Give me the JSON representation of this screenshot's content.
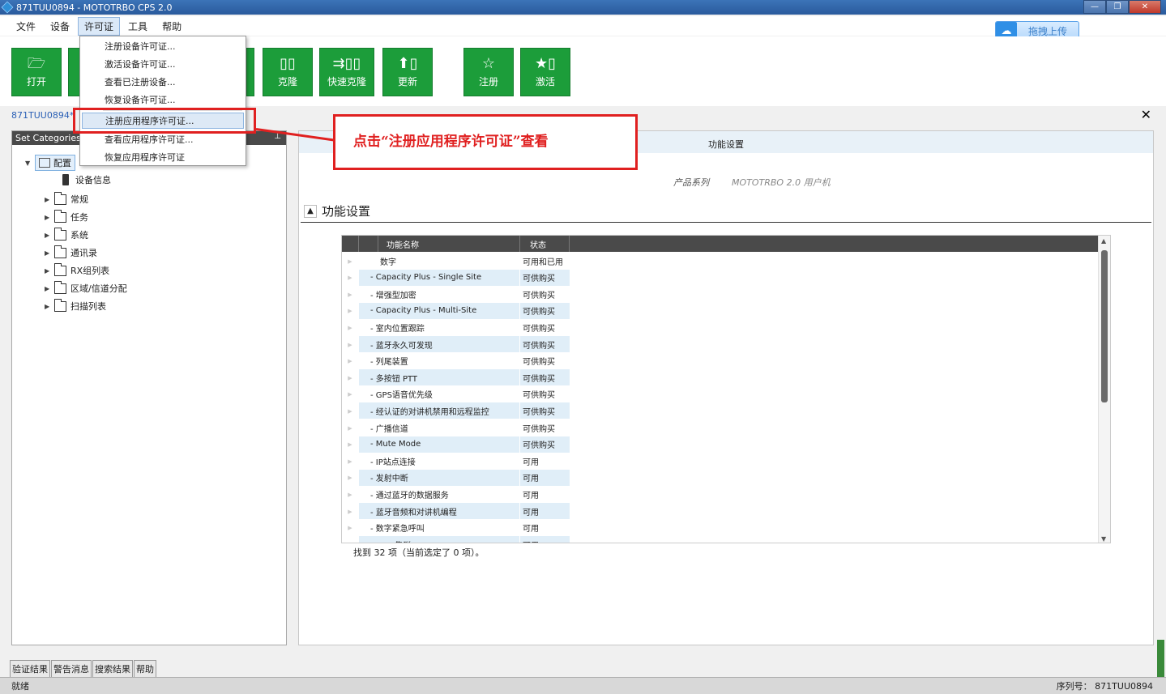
{
  "window": {
    "title": "871TUU0894 - MOTOTRBO CPS 2.0",
    "minimize": "—",
    "maximize": "❐",
    "close": "✕"
  },
  "menu": {
    "items": [
      "文件",
      "设备",
      "许可证",
      "工具",
      "帮助"
    ],
    "active_index": 2
  },
  "upload": {
    "label": "拖拽上传"
  },
  "toolbar": {
    "buttons": [
      {
        "label": "打开",
        "icon": "folder-open-icon"
      },
      {
        "label": "克隆",
        "icon": "clone-icon"
      },
      {
        "label": "快速克隆",
        "icon": "quick-clone-icon"
      },
      {
        "label": "更新",
        "icon": "update-icon"
      },
      {
        "label": "注册",
        "icon": "star-icon"
      },
      {
        "label": "激活",
        "icon": "activate-icon"
      }
    ]
  },
  "dropdown": {
    "items": [
      "注册设备许可证...",
      "激活设备许可证...",
      "查看已注册设备...",
      "恢复设备许可证...",
      "注册应用程序许可证...",
      "查看应用程序许可证...",
      "恢复应用程序许可证"
    ],
    "highlight_index": 4
  },
  "breadcrumb": "871TUU0894*",
  "left_panel": {
    "title": "Set Categories",
    "pin": "📌",
    "root": "配置",
    "device_info": "设备信息",
    "folders": [
      "常规",
      "任务",
      "系统",
      "通讯录",
      "RX组列表",
      "区域/信道分配",
      "扫描列表"
    ]
  },
  "main": {
    "section_title": "功能设置",
    "product_label": "产品系列",
    "product_value": "MOTOTRBO 2.0 用户机",
    "group_title": "功能设置",
    "columns": [
      "功能名称",
      "状态"
    ],
    "rows": [
      {
        "name": "数字",
        "status": "可用和已用",
        "head": true
      },
      {
        "name": "- Capacity Plus - Single Site",
        "status": "可供购买"
      },
      {
        "name": "- 增强型加密",
        "status": "可供购买"
      },
      {
        "name": "- Capacity Plus - Multi-Site",
        "status": "可供购买"
      },
      {
        "name": "- 室内位置跟踪",
        "status": "可供购买"
      },
      {
        "name": "- 蓝牙永久可发现",
        "status": "可供购买"
      },
      {
        "name": "- 列尾装置",
        "status": "可供购买"
      },
      {
        "name": "- 多按钮 PTT",
        "status": "可供购买"
      },
      {
        "name": "- GPS语音优先级",
        "status": "可供购买"
      },
      {
        "name": "- 经认证的对讲机禁用和远程监控",
        "status": "可供购买"
      },
      {
        "name": "- 广播信道",
        "status": "可供购买"
      },
      {
        "name": "- Mute Mode",
        "status": "可供购买"
      },
      {
        "name": "- IP站点连接",
        "status": "可用"
      },
      {
        "name": "- 发射中断",
        "status": "可用"
      },
      {
        "name": "- 通过蓝牙的数据服务",
        "status": "可用"
      },
      {
        "name": "- 蓝牙音频和对讲机编程",
        "status": "可用"
      },
      {
        "name": "- 数字紧急呼叫",
        "status": "可用"
      },
      {
        "name": "- DMR集群",
        "status": "可用"
      }
    ],
    "found_text": "找到 32 项（当前选定了 0 项）。"
  },
  "annotation": {
    "text": "点击“注册应用程序许可证”查看",
    "color": "#e02020"
  },
  "bottom_tabs": [
    "验证结果",
    "警告消息",
    "搜索结果",
    "帮助"
  ],
  "status": {
    "left": "就绪",
    "right": "序列号： 871TUU0894"
  },
  "colors": {
    "toolbar_green": "#1c9d3a",
    "accent_blue": "#2a5fb5"
  }
}
